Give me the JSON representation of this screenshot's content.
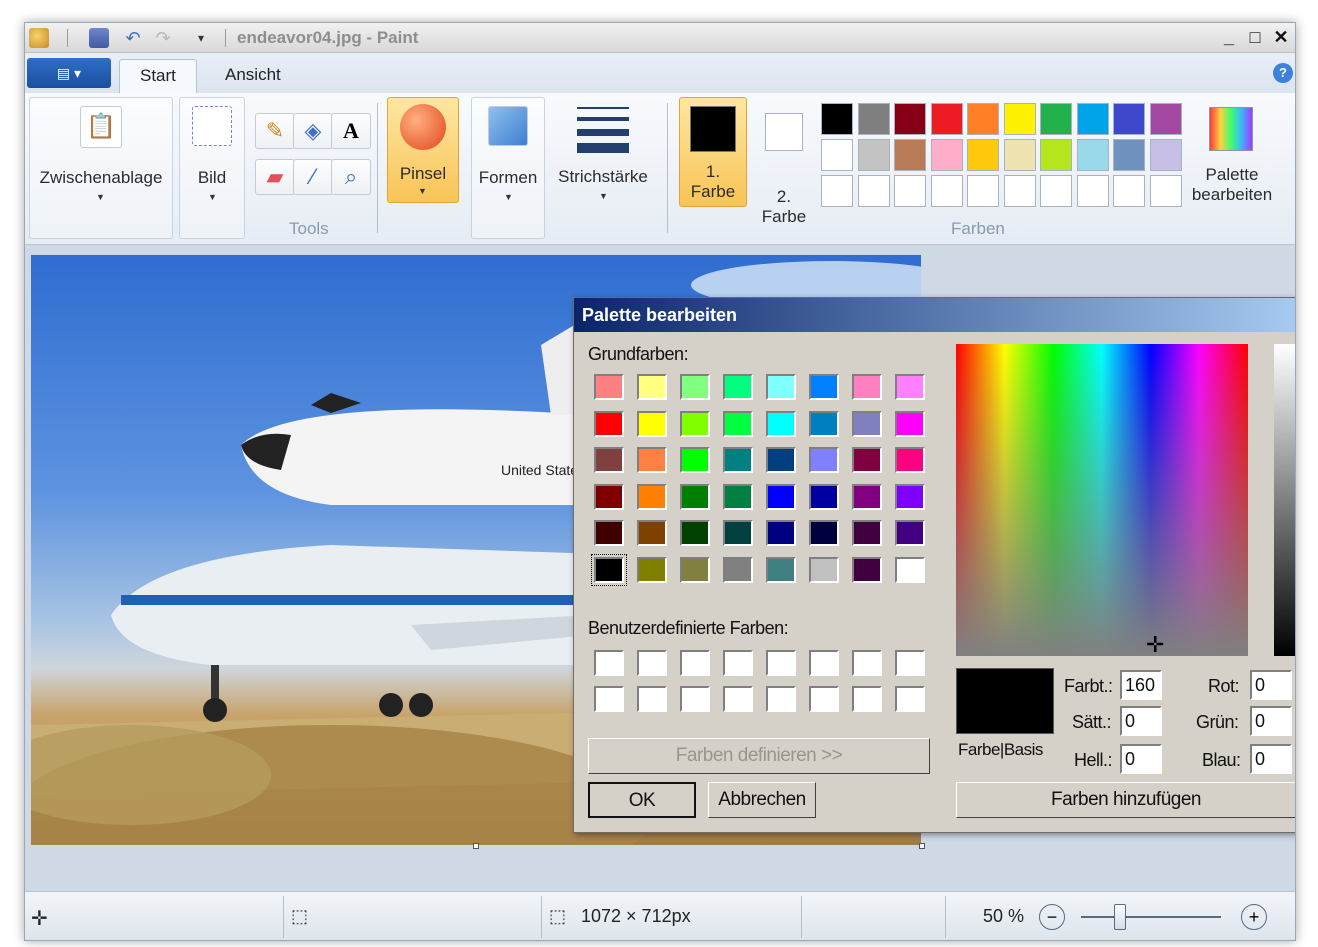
{
  "window": {
    "title": "endeavor04.jpg - Paint"
  },
  "tabs": [
    {
      "label": "Start",
      "active": true
    },
    {
      "label": "Ansicht",
      "active": false
    }
  ],
  "ribbon": {
    "clipboard": "Zwischenablage",
    "image": "Bild",
    "tools_group": "Tools",
    "brush": "Pinsel",
    "shapes": "Formen",
    "stroke": "Strichstärke",
    "color1_num": "1.",
    "color1_label": "Farbe",
    "color2_num": "2.",
    "color2_label": "Farbe",
    "colors_group": "Farben",
    "edit_palette_1": "Palette",
    "edit_palette_2": "bearbeiten",
    "palette_row1": [
      "#000000",
      "#7f7f7f",
      "#880015",
      "#ed1c24",
      "#ff7f27",
      "#fff200",
      "#22b14c",
      "#00a2e8",
      "#3f48cc",
      "#a349a4"
    ],
    "palette_row2": [
      "#ffffff",
      "#c3c3c3",
      "#b97a57",
      "#ffaec9",
      "#ffc90e",
      "#efe4b0",
      "#b5e61d",
      "#99d9ea",
      "#7092be",
      "#c8bfe7"
    ]
  },
  "dialog": {
    "title": "Palette bearbeiten",
    "basic_label": "Grundfarben:",
    "basic_colors": [
      [
        "#ff8080",
        "#ffff80",
        "#80ff80",
        "#00ff80",
        "#80ffff",
        "#0080ff",
        "#ff80c0",
        "#ff80ff"
      ],
      [
        "#ff0000",
        "#ffff00",
        "#80ff00",
        "#00ff40",
        "#00ffff",
        "#0080c0",
        "#8080c0",
        "#ff00ff"
      ],
      [
        "#804040",
        "#ff8040",
        "#00ff00",
        "#008080",
        "#004080",
        "#8080ff",
        "#800040",
        "#ff0080"
      ],
      [
        "#800000",
        "#ff8000",
        "#008000",
        "#008040",
        "#0000ff",
        "#0000a0",
        "#800080",
        "#8000ff"
      ],
      [
        "#400000",
        "#804000",
        "#004000",
        "#004040",
        "#000080",
        "#000040",
        "#400040",
        "#400080"
      ],
      [
        "#000000",
        "#808000",
        "#808040",
        "#808080",
        "#408080",
        "#c0c0c0",
        "#400040",
        "#ffffff"
      ]
    ],
    "custom_label": "Benutzerdefinierte Farben:",
    "define_button": "Farben definieren >>",
    "ok_button": "OK",
    "cancel_button": "Abbrechen",
    "preview_label": "Farbe|Basis",
    "hue_label": "Farbt.:",
    "hue": "160",
    "sat_label": "Sätt.:",
    "sat": "0",
    "lum_label": "Hell.:",
    "lum": "0",
    "red_label": "Rot:",
    "red": "0",
    "green_label": "Grün:",
    "green": "0",
    "blue_label": "Blau:",
    "blue": "0",
    "add_button": "Farben hinzufügen"
  },
  "status": {
    "dimensions": "1072 × 712px",
    "zoom": "50 %",
    "zoom_level": 0.5
  }
}
